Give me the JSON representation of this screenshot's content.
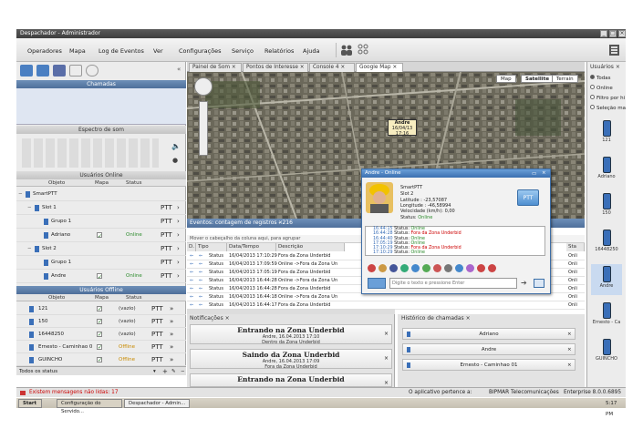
{
  "window": {
    "title": "Despachador - Administrador"
  },
  "menu": [
    "Operadores",
    "Mapa",
    "Log de Eventos",
    "Ver",
    "Configurações",
    "Serviço",
    "Relatórios",
    "Ajuda"
  ],
  "left": {
    "chamadas": "Chamadas",
    "espectro": "Espectro de som",
    "online_header": "Usuários Online",
    "online_cols": [
      "Objeto",
      "Mapa",
      "Status"
    ],
    "online_rows": [
      {
        "name": "SmartPTT",
        "map": "",
        "status": "",
        "level": 0,
        "ptt": ""
      },
      {
        "name": "Slot 1",
        "map": "",
        "status": "",
        "level": 1,
        "ptt": "PTT"
      },
      {
        "name": "Grupo 1",
        "map": "",
        "status": "",
        "level": 2,
        "ptt": "PTT"
      },
      {
        "name": "Adriano",
        "map": "✓",
        "status": "Online",
        "level": 2,
        "ptt": "PTT"
      },
      {
        "name": "Slot 2",
        "map": "",
        "status": "",
        "level": 1,
        "ptt": "PTT"
      },
      {
        "name": "Grupo 1",
        "map": "",
        "status": "",
        "level": 2,
        "ptt": "PTT"
      },
      {
        "name": "Andre",
        "map": "✓",
        "status": "Online",
        "level": 2,
        "ptt": "PTT"
      }
    ],
    "offline_header": "Usuários Offline",
    "offline_cols": [
      "Objeto",
      "Mapa",
      "Status"
    ],
    "offline_rows": [
      {
        "name": "121",
        "status": "(vazio)"
      },
      {
        "name": "150",
        "status": "(vazio)"
      },
      {
        "name": "16448250",
        "status": "(vazio)"
      },
      {
        "name": "Ernesto - Caminhao 0",
        "status": "Offline"
      },
      {
        "name": "GUINCHO",
        "status": "Offline"
      }
    ],
    "filter": "Todos os status"
  },
  "tabs": [
    "Painel de Som",
    "Pontos de Interesse",
    "Console",
    "4",
    "Google Map"
  ],
  "map": {
    "buttons": [
      "Map",
      "Satellite",
      "Terrain"
    ],
    "marker_name": "Andre",
    "marker_date": "16/04/13 17:16"
  },
  "popup": {
    "title": "Andre - Online",
    "name": "SmartPTT",
    "slot": "Slot 2",
    "latitude": "Latitude : -23,57087",
    "longitude": "Longitude : -46,58994",
    "speed": "Velocidade (km/h): 0,00",
    "status_label": "Status:",
    "status_value": "Online",
    "ptt": "PTT",
    "log": [
      {
        "time": "16:44:15",
        "label": "Status:",
        "value": "Online",
        "color": "#2a8a2a"
      },
      {
        "time": "16:44:28",
        "label": "Status:",
        "value": "Fora da Zona Underbid",
        "color": "#c00"
      },
      {
        "time": "16:44:40",
        "label": "Status:",
        "value": "Online",
        "color": "#2a8a2a"
      },
      {
        "time": "17:05:19",
        "label": "Status:",
        "value": "Online",
        "color": "#2a8a2a"
      },
      {
        "time": "17:10:29",
        "label": "Status:",
        "value": "Fora da Zona Underbid",
        "color": "#c00"
      },
      {
        "time": "17:10:29",
        "label": "Status:",
        "value": "Online",
        "color": "#2a8a2a"
      }
    ],
    "input_placeholder": "Digite o texto e pressione Enter"
  },
  "events": {
    "header": "Eventos: contagem de registros - 216",
    "group_hint": "Mover o cabeçalho da coluna aqui, para agrupar",
    "cols": [
      "D.",
      "Tipo",
      "Data/Tempo",
      "Descrição",
      "Sta"
    ],
    "rows": [
      {
        "type": "Status",
        "date": "16/04/2013 17:10:29",
        "desc": "Fora da Zona Underbid",
        "st": "Onli"
      },
      {
        "type": "Status",
        "date": "16/04/2013 17:09:59",
        "desc": "Online ->Fora da Zona Un",
        "st": "Onli"
      },
      {
        "type": "Status",
        "date": "16/04/2013 17:05:19",
        "desc": "Fora da Zona Underbid",
        "st": "Onli"
      },
      {
        "type": "Status",
        "date": "16/04/2013 16:44:28",
        "desc": "Online ->Fora da Zona Un",
        "st": "Onli"
      },
      {
        "type": "Status",
        "date": "16/04/2013 16:44:28",
        "desc": "Fora da Zona Underbid",
        "st": "Onli"
      },
      {
        "type": "Status",
        "date": "16/04/2013 16:44:18",
        "desc": "Online ->Fora da Zona Un",
        "st": "Onli"
      },
      {
        "type": "Status",
        "date": "16/04/2013 16:44:17",
        "desc": "Fora da Zona Underbid",
        "st": "Onli"
      }
    ]
  },
  "notifications": {
    "title": "Notificações",
    "items": [
      {
        "title": "Entrando na Zona Underbid",
        "l1": "Andre, 16.04.2013 17:10",
        "l2": "Dentro da Zona Underbid"
      },
      {
        "title": "Saindo da Zona Underbid",
        "l1": "Andre, 16.04.2013 17:09",
        "l2": "Fora da Zona Underbid"
      },
      {
        "title": "Entrando na Zona Underbid",
        "l1": "",
        "l2": ""
      }
    ]
  },
  "history": {
    "title": "Histórico de chamadas",
    "items": [
      "Adriano",
      "Andre",
      "Ernesto - Caminhao 01"
    ]
  },
  "right": {
    "header": "Usuários",
    "radios": [
      "Todas",
      "Online",
      "Filtro por hi",
      "Seleção ma"
    ],
    "devices": [
      "121",
      "Adriano",
      "150",
      "16448250",
      "Andre",
      "Ernesto - Ca",
      "GUINCHO"
    ]
  },
  "status": {
    "left": "Existem mensagens não lidas: 17",
    "mid": "O aplicativo pertence a:",
    "owner": "BIPMAR Telecomunicações",
    "version": "Enterprise 8.0.0.6895"
  },
  "taskbar": {
    "start": "Start",
    "items": [
      "Configuração do Servido...",
      "Despachador - Admin..."
    ],
    "time": "5:17 PM"
  },
  "colors": {
    "accent": "#4e6f9a",
    "online": "#2a8a2a",
    "offline": "#c88a00",
    "alert": "#c00"
  }
}
